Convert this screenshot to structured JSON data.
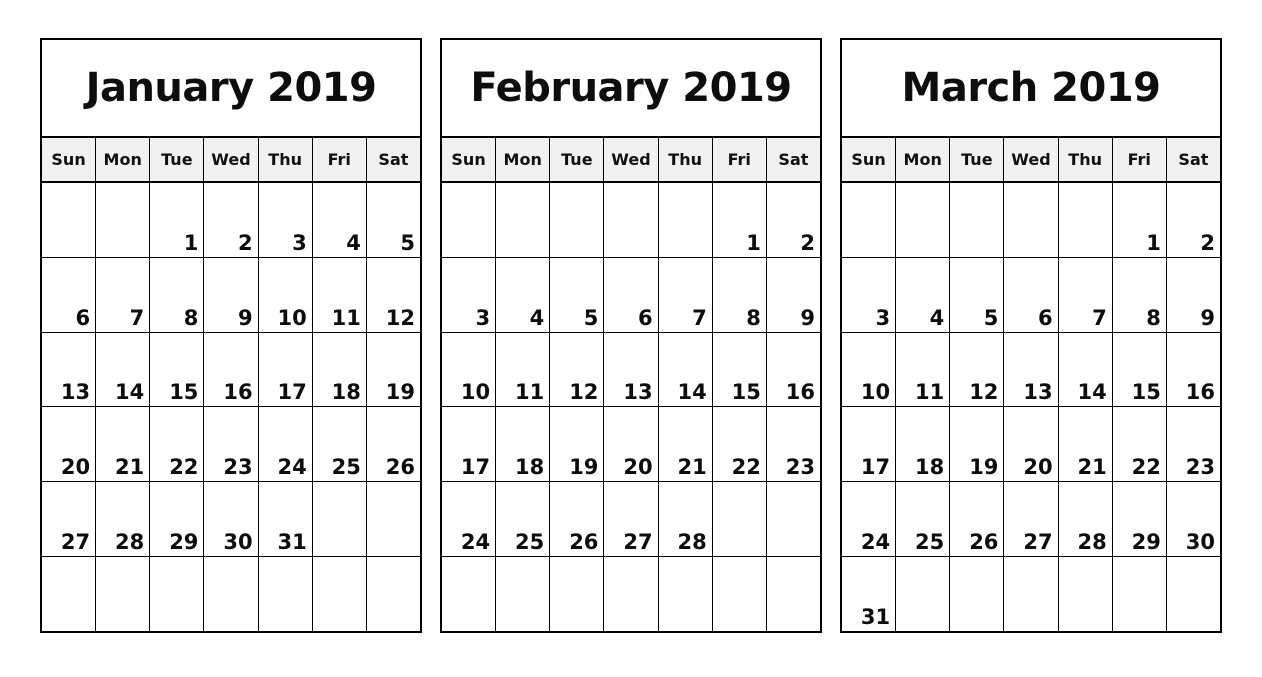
{
  "page": {
    "background_color": "#ffffff",
    "grid_line_color": "#000000",
    "weekday_header_background": "#f1f1f1",
    "text_color": "#0d0d0d"
  },
  "weekday_labels": [
    "Sun",
    "Mon",
    "Tue",
    "Wed",
    "Thu",
    "Fri",
    "Sat"
  ],
  "months": [
    {
      "title": "January 2019",
      "name": "January",
      "year": "2019",
      "start_weekday": "Tue",
      "days_in_month": 31,
      "weeks": [
        [
          "",
          "",
          "1",
          "2",
          "3",
          "4",
          "5"
        ],
        [
          "6",
          "7",
          "8",
          "9",
          "10",
          "11",
          "12"
        ],
        [
          "13",
          "14",
          "15",
          "16",
          "17",
          "18",
          "19"
        ],
        [
          "20",
          "21",
          "22",
          "23",
          "24",
          "25",
          "26"
        ],
        [
          "27",
          "28",
          "29",
          "30",
          "31",
          "",
          ""
        ],
        [
          "",
          "",
          "",
          "",
          "",
          "",
          ""
        ]
      ]
    },
    {
      "title": "February 2019",
      "name": "February",
      "year": "2019",
      "start_weekday": "Fri",
      "days_in_month": 28,
      "weeks": [
        [
          "",
          "",
          "",
          "",
          "",
          "1",
          "2"
        ],
        [
          "3",
          "4",
          "5",
          "6",
          "7",
          "8",
          "9"
        ],
        [
          "10",
          "11",
          "12",
          "13",
          "14",
          "15",
          "16"
        ],
        [
          "17",
          "18",
          "19",
          "20",
          "21",
          "22",
          "23"
        ],
        [
          "24",
          "25",
          "26",
          "27",
          "28",
          "",
          ""
        ],
        [
          "",
          "",
          "",
          "",
          "",
          "",
          ""
        ]
      ]
    },
    {
      "title": "March 2019",
      "name": "March",
      "year": "2019",
      "start_weekday": "Fri",
      "days_in_month": 31,
      "weeks": [
        [
          "",
          "",
          "",
          "",
          "",
          "1",
          "2"
        ],
        [
          "3",
          "4",
          "5",
          "6",
          "7",
          "8",
          "9"
        ],
        [
          "10",
          "11",
          "12",
          "13",
          "14",
          "15",
          "16"
        ],
        [
          "17",
          "18",
          "19",
          "20",
          "21",
          "22",
          "23"
        ],
        [
          "24",
          "25",
          "26",
          "27",
          "28",
          "29",
          "30"
        ],
        [
          "31",
          "",
          "",
          "",
          "",
          "",
          ""
        ]
      ]
    }
  ],
  "watermark": {
    "text": ""
  }
}
